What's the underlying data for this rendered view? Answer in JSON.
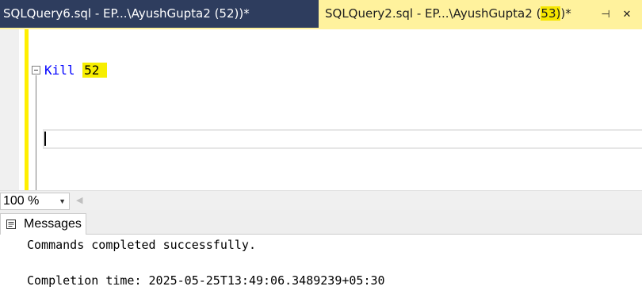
{
  "tabs": [
    {
      "label": "SQLQuery6.sql - EP...\\AyushGupta2 (52))*",
      "active": false
    },
    {
      "label_before": "SQLQuery2.sql - EP...\\AyushGupta2 (",
      "label_highlight": "53)",
      "label_after": ")*",
      "active": true
    }
  ],
  "tab_icons": {
    "pin": "pin-icon",
    "close": "close-icon"
  },
  "editor": {
    "keyword": "Kill",
    "argument": "52"
  },
  "zoom": {
    "value": "100 %"
  },
  "results": {
    "tab_label": "Messages",
    "lines": [
      "Commands completed successfully.",
      "Completion time: 2025-05-25T13:49:06.3489239+05:30"
    ]
  },
  "colors": {
    "inactive_tab": "#2e3d5e",
    "active_tab": "#fff29d",
    "highlight": "#f5e600",
    "keyword": "#0000ff"
  }
}
